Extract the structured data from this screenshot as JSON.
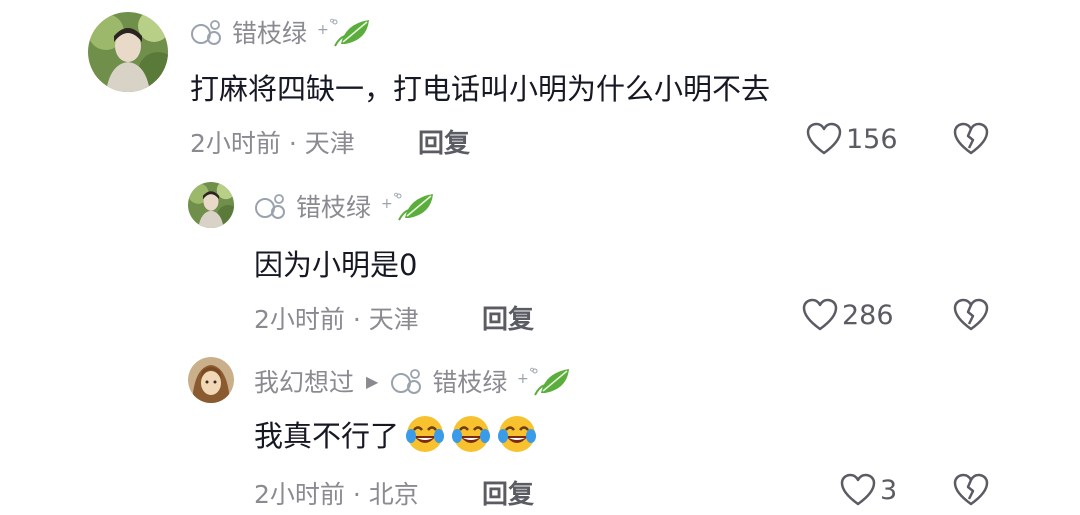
{
  "comments": [
    {
      "username": "错枝绿",
      "text": "打麻将四缺一，打电话叫小明为什么小明不去",
      "meta": "2小时前 · 天津",
      "reply_label": "回复",
      "likes": "156"
    },
    {
      "username": "错枝绿",
      "text": "因为小明是0",
      "meta": "2小时前 · 天津",
      "reply_label": "回复",
      "likes": "286"
    },
    {
      "username": "我幻想过",
      "reply_to": "错枝绿",
      "text": "我真不行了",
      "emojis": [
        "laughing-tears-emoji",
        "laughing-tears-emoji",
        "laughing-tears-emoji"
      ],
      "meta": "2小时前 · 北京",
      "reply_label": "回复",
      "likes": "3"
    }
  ],
  "icons": {
    "like": "heart-outline-icon",
    "dislike": "broken-heart-icon",
    "name_prefix": "bubbles-icon",
    "name_suffix": "leaf-icon",
    "reply_arrow": "triangle-right-icon"
  },
  "colors": {
    "text": "#161823",
    "muted": "#8a8b91",
    "leaf": "#4caf50"
  }
}
